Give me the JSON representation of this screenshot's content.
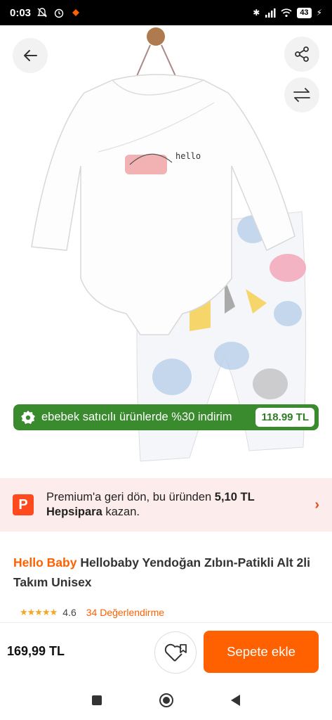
{
  "status_bar": {
    "time": "0:03",
    "battery": "43"
  },
  "product_image": {
    "alt_description_icon": "baby-bodysuit-and-footed-pants-image",
    "promo": {
      "text": "ebebek satıcılı ürünlerde %30 indirim",
      "price": "118.99 TL"
    }
  },
  "premium": {
    "part1": "Premium'a geri dön, bu üründen ",
    "amount": "5,10 TL",
    "brand": "Hepsipara",
    "part2": " kazan."
  },
  "product": {
    "brand": "Hello Baby",
    "name": " Hellobaby Yendoğan Zıbın-Patikli Alt 2li Takım Unisex",
    "rating": "4.6",
    "reviews": "34 Değerlendirme",
    "stars": "★★★★★"
  },
  "bottom": {
    "price": "169,99 TL",
    "add_to_cart": "Sepete ekle"
  },
  "colors": {
    "accent": "#ff6000",
    "promo_green": "#3a8a2e",
    "premium_bg": "#fdecec"
  }
}
